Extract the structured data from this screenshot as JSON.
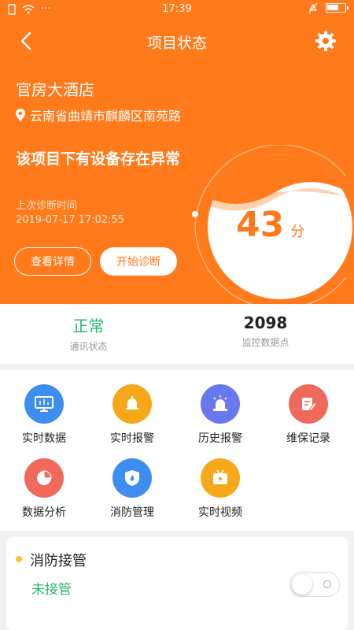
{
  "status_bar": {
    "time": "17:39",
    "dots": "···"
  },
  "nav": {
    "title": "项目状态"
  },
  "project": {
    "name": "官房大酒店",
    "address": "云南省曲靖市麒麟区南苑路",
    "warning": "该项目下有设备存在异常",
    "last_diag_label": "上次诊断时间",
    "last_diag_time": "2019-07-17 17:02:55",
    "btn_details": "查看详情",
    "btn_diagnose": "开始诊断"
  },
  "score": {
    "value": "43",
    "unit": "分"
  },
  "stats": {
    "comm_value": "正常",
    "comm_label": "通讯状态",
    "points_value": "2098",
    "points_label": "监控数据点"
  },
  "grid": [
    {
      "label": "实时数据",
      "icon": "monitor-icon",
      "color": "#3d8ef0"
    },
    {
      "label": "实时报警",
      "icon": "bell-icon",
      "color": "#f6a81a"
    },
    {
      "label": "历史报警",
      "icon": "siren-icon",
      "color": "#6a78ee"
    },
    {
      "label": "维保记录",
      "icon": "edit-icon",
      "color": "#ef6a5a"
    },
    {
      "label": "数据分析",
      "icon": "pie-chart-icon",
      "color": "#ef6a5a"
    },
    {
      "label": "消防管理",
      "icon": "shield-icon",
      "color": "#3d8ef0"
    },
    {
      "label": "实时视频",
      "icon": "video-icon",
      "color": "#f6a81a"
    }
  ],
  "fire_card": {
    "title": "消防接管",
    "status": "未接管"
  },
  "colors": {
    "brand": "#ff7a1a",
    "green": "#2bb673"
  }
}
